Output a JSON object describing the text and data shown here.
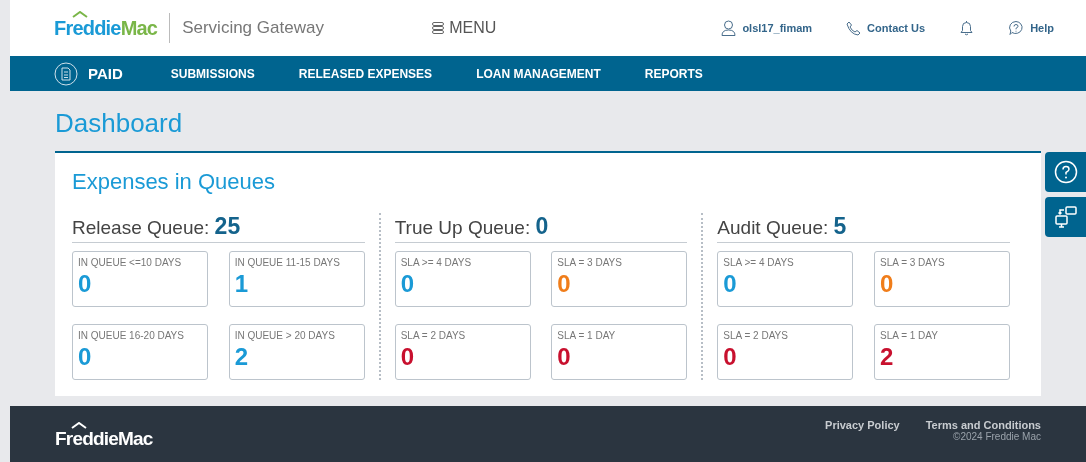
{
  "header": {
    "logo": {
      "first": "Freddie",
      "second": "Mac"
    },
    "app_title": "Servicing Gateway",
    "menu": "MENU",
    "user": "olsl17_fimam",
    "contact": "Contact Us",
    "help": "Help"
  },
  "nav": {
    "brand": "PAID",
    "items": [
      {
        "label": "SUBMISSIONS"
      },
      {
        "label": "RELEASED EXPENSES"
      },
      {
        "label": "LOAN MANAGEMENT"
      },
      {
        "label": "REPORTS"
      }
    ]
  },
  "page_title": "Dashboard",
  "card": {
    "title": "Expenses in Queues",
    "queues": [
      {
        "name": "Release Queue:",
        "total": "25",
        "tiles": [
          {
            "label": "IN QUEUE <=10 DAYS",
            "value": "0",
            "color": "#1a9ad6"
          },
          {
            "label": "IN QUEUE 11-15 DAYS",
            "value": "1",
            "color": "#1a9ad6"
          },
          {
            "label": "IN QUEUE 16-20 DAYS",
            "value": "0",
            "color": "#1a9ad6"
          },
          {
            "label": "IN QUEUE > 20 DAYS",
            "value": "2",
            "color": "#1a9ad6"
          }
        ]
      },
      {
        "name": "True Up Queue:",
        "total": "0",
        "tiles": [
          {
            "label": "SLA >= 4 DAYS",
            "value": "0",
            "color": "#1a9ad6"
          },
          {
            "label": "SLA = 3 DAYS",
            "value": "0",
            "color": "#f07d1a"
          },
          {
            "label": "SLA = 2 DAYS",
            "value": "0",
            "color": "#c8102e"
          },
          {
            "label": "SLA = 1 DAY",
            "value": "0",
            "color": "#c8102e"
          }
        ]
      },
      {
        "name": "Audit Queue:",
        "total": "5",
        "tiles": [
          {
            "label": "SLA >= 4 DAYS",
            "value": "0",
            "color": "#1a9ad6"
          },
          {
            "label": "SLA = 3 DAYS",
            "value": "0",
            "color": "#f07d1a"
          },
          {
            "label": "SLA = 2 DAYS",
            "value": "0",
            "color": "#c8102e"
          },
          {
            "label": "SLA = 1 DAY",
            "value": "2",
            "color": "#c8102e"
          }
        ]
      }
    ]
  },
  "footer": {
    "logo": "FreddieMac",
    "links": [
      {
        "label": "Privacy Policy"
      },
      {
        "label": "Terms and Conditions"
      }
    ],
    "copyright": "©2024 Freddie Mac"
  }
}
